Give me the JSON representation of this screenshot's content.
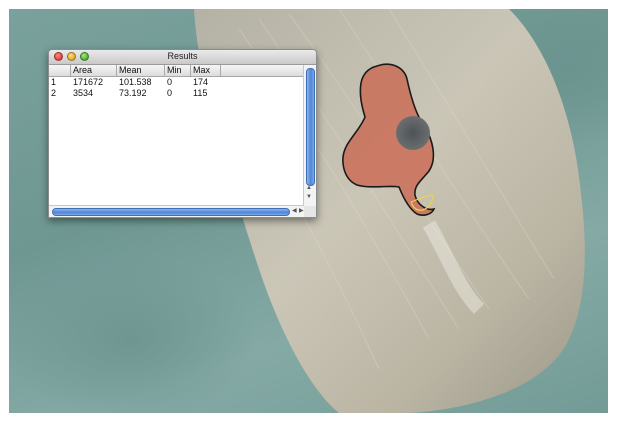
{
  "window": {
    "title": "Results"
  },
  "table": {
    "columns": [
      "",
      "Area",
      "Mean",
      "Min",
      "Max"
    ],
    "rows": [
      [
        "1",
        "171672",
        "101.538",
        "0",
        "174"
      ],
      [
        "2",
        "3534",
        "73.192",
        "0",
        "115"
      ]
    ]
  },
  "colors": {
    "background_teal": "#7aa19c",
    "tooth_surface": "#c9c2b2",
    "selection_fill": "#c9705a",
    "selection_outline": "#1a1a1a",
    "small_selection_outline": "#e6d44a",
    "scrollbar_thumb": "#4f86d6"
  },
  "icons": {
    "close": "close-icon",
    "minimize": "minimize-icon",
    "zoom": "zoom-icon",
    "scroll_up": "arrow-up-icon",
    "scroll_down": "arrow-down-icon",
    "scroll_left": "arrow-left-icon",
    "scroll_right": "arrow-right-icon"
  }
}
